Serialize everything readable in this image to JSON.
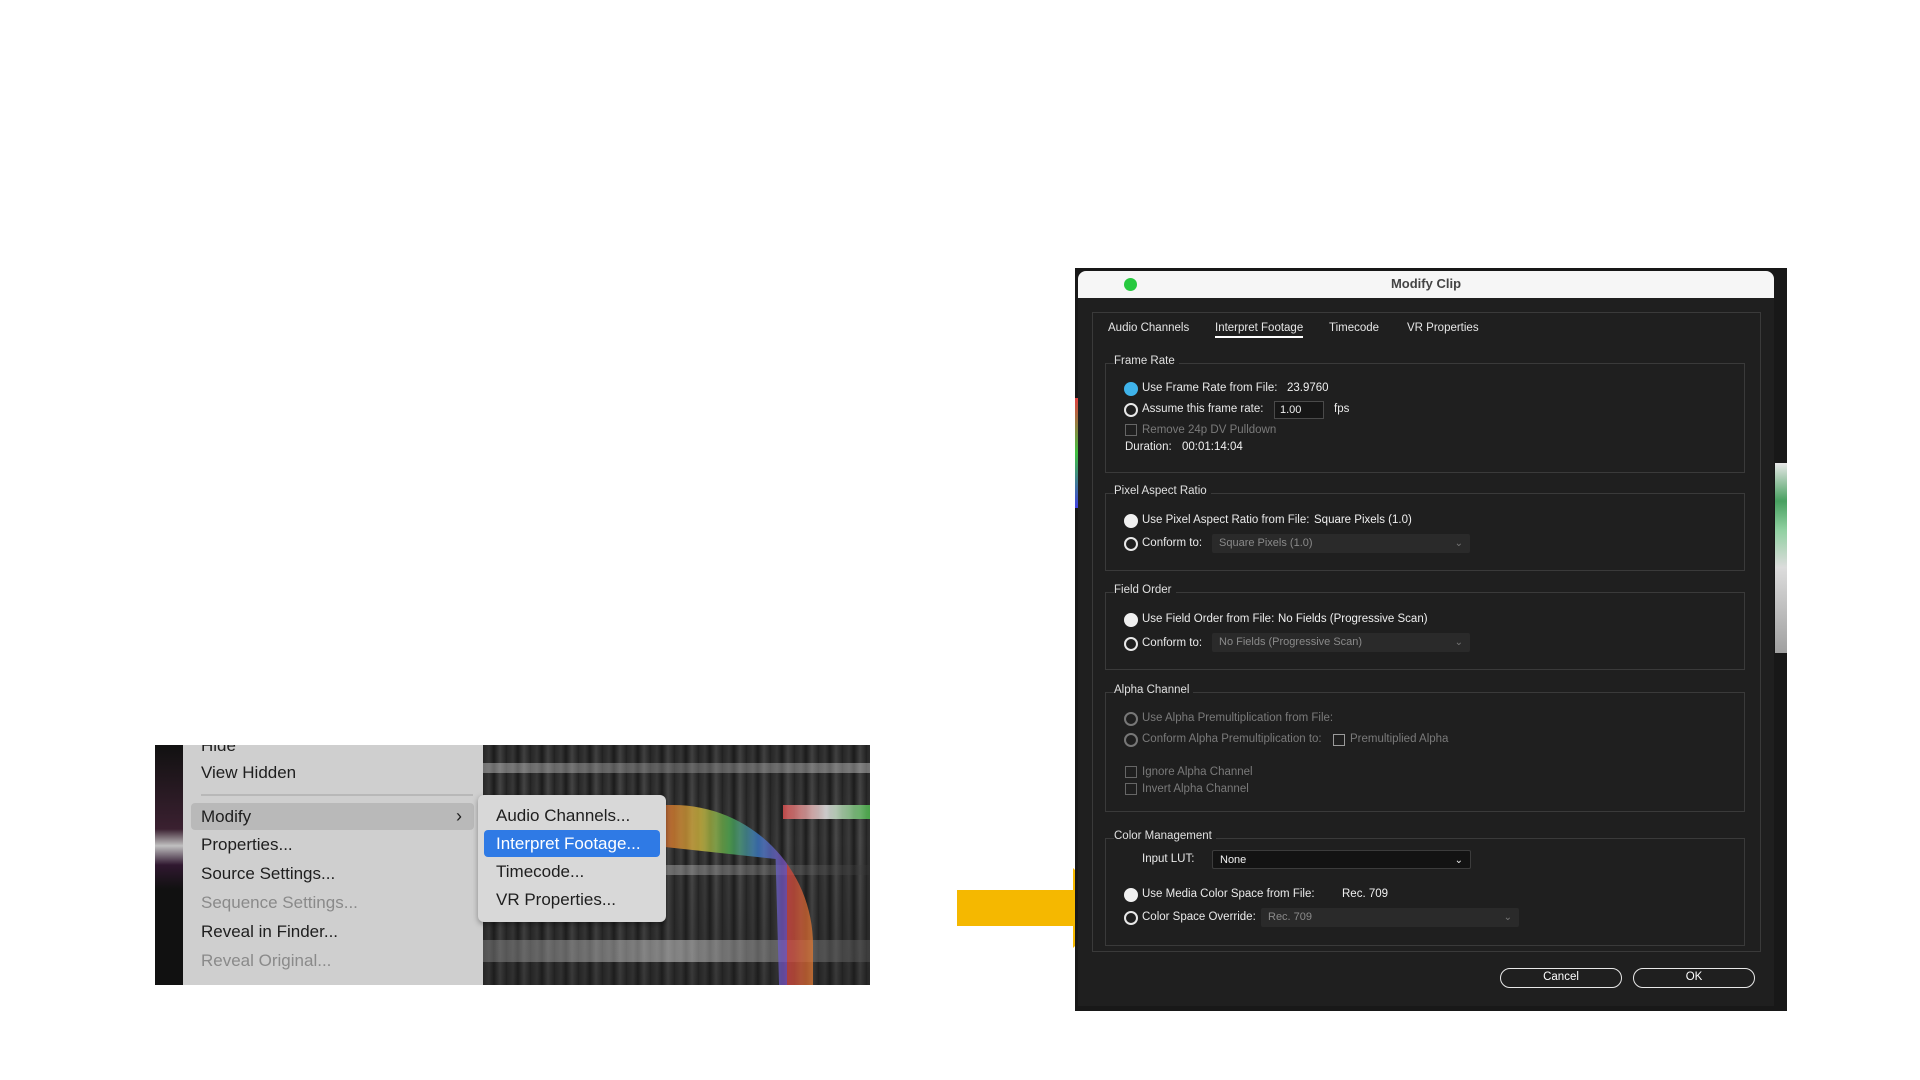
{
  "context_menu": {
    "items": [
      {
        "label": "Hide",
        "state": "normal"
      },
      {
        "label": "View Hidden",
        "state": "normal"
      },
      {
        "label": "Modify",
        "state": "active"
      },
      {
        "label": "Properties...",
        "state": "normal"
      },
      {
        "label": "Source Settings...",
        "state": "normal"
      },
      {
        "label": "Sequence Settings...",
        "state": "disabled"
      },
      {
        "label": "Reveal in Finder...",
        "state": "normal"
      },
      {
        "label": "Reveal Original...",
        "state": "disabled"
      }
    ],
    "submenu_icon": "chevron-right-icon",
    "submenu": [
      {
        "label": "Audio Channels..."
      },
      {
        "label": "Interpret Footage...",
        "selected": true
      },
      {
        "label": "Timecode..."
      },
      {
        "label": "VR Properties..."
      }
    ]
  },
  "arrow": {
    "color": "#F5B800",
    "icon": "arrow-right-icon"
  },
  "dialog": {
    "title": "Modify Clip",
    "window_dot_color": "#27c93f",
    "tabs": [
      "Audio Channels",
      "Interpret Footage",
      "Timecode",
      "VR Properties"
    ],
    "active_tab": "Interpret Footage",
    "frame_rate": {
      "group_label": "Frame Rate",
      "use_from_file_label": "Use Frame Rate from File:",
      "use_from_file_value": "23.9760",
      "assume_label": "Assume this frame rate:",
      "assume_value": "1.00",
      "assume_unit": "fps",
      "remove_pulldown_label": "Remove 24p DV Pulldown",
      "duration_label": "Duration:",
      "duration_value": "00:01:14:04"
    },
    "pixel_aspect": {
      "group_label": "Pixel Aspect Ratio",
      "use_from_file_label": "Use Pixel Aspect Ratio from File:",
      "use_from_file_value": "Square Pixels (1.0)",
      "conform_label": "Conform to:",
      "conform_value": "Square Pixels (1.0)"
    },
    "field_order": {
      "group_label": "Field Order",
      "use_from_file_label": "Use Field Order from File:",
      "use_from_file_value": "No Fields (Progressive Scan)",
      "conform_label": "Conform to:",
      "conform_value": "No Fields (Progressive Scan)"
    },
    "alpha_channel": {
      "group_label": "Alpha Channel",
      "use_premult_label": "Use Alpha Premultiplication from File:",
      "conform_premult_label": "Conform Alpha Premultiplication to:",
      "premultiplied_label": "Premultiplied Alpha",
      "ignore_label": "Ignore Alpha Channel",
      "invert_label": "Invert Alpha Channel"
    },
    "color_management": {
      "group_label": "Color Management",
      "input_lut_label": "Input LUT:",
      "input_lut_value": "None",
      "use_media_label": "Use Media Color Space from File:",
      "use_media_value": "Rec. 709",
      "override_label": "Color Space Override:",
      "override_value": "Rec. 709"
    },
    "buttons": {
      "cancel": "Cancel",
      "ok": "OK"
    }
  }
}
